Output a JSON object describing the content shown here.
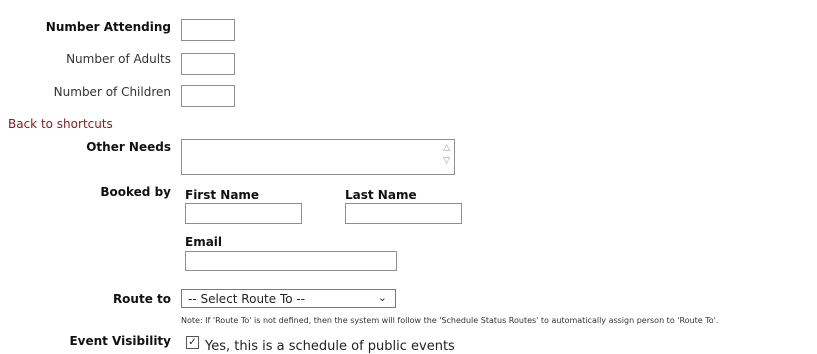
{
  "attendance": {
    "number_attending_label": "Number Attending",
    "number_attending_value": "",
    "number_adults_label": "Number of Adults",
    "number_adults_value": "",
    "number_children_label": "Number of Children",
    "number_children_value": ""
  },
  "back_link": "Back to shortcuts",
  "other_needs": {
    "label": "Other Needs",
    "value": ""
  },
  "booked_by": {
    "label": "Booked by",
    "first_name_label": "First Name",
    "first_name_value": "",
    "last_name_label": "Last Name",
    "last_name_value": "",
    "email_label": "Email",
    "email_value": ""
  },
  "route_to": {
    "label": "Route to",
    "selected": "-- Select Route To --",
    "note": "Note: If 'Route To' is not defined, then the system will follow the 'Schedule Status Routes' to automatically assign person to 'Route To'."
  },
  "event_visibility": {
    "label": "Event Visibility",
    "checkbox_checked": true,
    "checkbox_label": "Yes, this is a schedule of public events"
  },
  "colors": {
    "link": "#8b1a1a",
    "border": "#8f8f8f"
  },
  "icons": {
    "scroll_up": "chevron-up-icon",
    "scroll_down": "chevron-down-icon",
    "select": "chevron-down-icon",
    "check": "checkmark-icon"
  }
}
